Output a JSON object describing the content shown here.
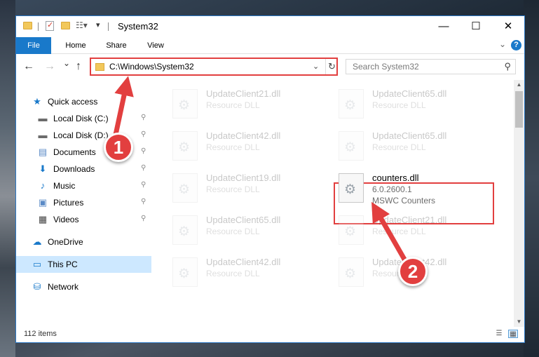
{
  "titlebar": {
    "title": "System32",
    "minimize": "—",
    "maximize": "☐",
    "close": "✕"
  },
  "ribbon": {
    "tabs": [
      "File",
      "Home",
      "Share",
      "View"
    ],
    "help": "?"
  },
  "navbar": {
    "back": "←",
    "forward": "→",
    "recent": "⌄",
    "up": "↑",
    "address": "C:\\Windows\\System32",
    "refresh": "↻",
    "search_placeholder": "Search System32"
  },
  "sidebar": {
    "items": [
      {
        "label": "Quick access",
        "icon": "star-icon",
        "glyph": "★",
        "color": "#1979ca"
      },
      {
        "label": "Local Disk (C:)",
        "icon": "drive-icon",
        "glyph": "▬",
        "color": "#6b6b6b",
        "pinned": true
      },
      {
        "label": "Local Disk (D:)",
        "icon": "drive-icon",
        "glyph": "▬",
        "color": "#6b6b6b",
        "pinned": true
      },
      {
        "label": "Documents",
        "icon": "documents-icon",
        "glyph": "▤",
        "color": "#5a8ac6",
        "pinned": true
      },
      {
        "label": "Downloads",
        "icon": "download-icon",
        "glyph": "⬇",
        "color": "#1979ca",
        "pinned": true
      },
      {
        "label": "Music",
        "icon": "music-icon",
        "glyph": "♪",
        "color": "#1979ca",
        "pinned": true
      },
      {
        "label": "Pictures",
        "icon": "pictures-icon",
        "glyph": "▣",
        "color": "#5a8ac6",
        "pinned": true
      },
      {
        "label": "Videos",
        "icon": "videos-icon",
        "glyph": "▦",
        "color": "#444",
        "pinned": true
      },
      {
        "label": "OneDrive",
        "icon": "cloud-icon",
        "glyph": "☁",
        "color": "#1979ca"
      },
      {
        "label": "This PC",
        "icon": "computer-icon",
        "glyph": "▭",
        "color": "#1979ca"
      },
      {
        "label": "Network",
        "icon": "network-icon",
        "glyph": "⛁",
        "color": "#1979ca"
      }
    ],
    "pin_glyph": "📌"
  },
  "files": [
    {
      "name": "UpdateClient21.dll",
      "type": "Resource DLL"
    },
    {
      "name": "UpdateClient65.dll",
      "type": "Resource DLL"
    },
    {
      "name": "UpdateClient42.dll",
      "type": "Resource DLL"
    },
    {
      "name": "UpdateClient65.dll",
      "type": "Resource DLL"
    },
    {
      "name": "UpdateClient19.dll",
      "type": "Resource DLL"
    },
    {
      "name": "counters.dll",
      "version": "6.0.2600.1",
      "type": "MSWC Counters"
    },
    {
      "name": "UpdateClient65.dll",
      "type": "Resource DLL"
    },
    {
      "name": "UpdateClient21.dll",
      "type": "Resource DLL"
    },
    {
      "name": "UpdateClient42.dll",
      "type": "Resource DLL"
    },
    {
      "name": "UpdateClient42.dll",
      "type": "Resource DLL"
    }
  ],
  "status": {
    "item_count": "112 items"
  },
  "annotations": {
    "step1": "1",
    "step2": "2",
    "color": "#e23f3f"
  }
}
